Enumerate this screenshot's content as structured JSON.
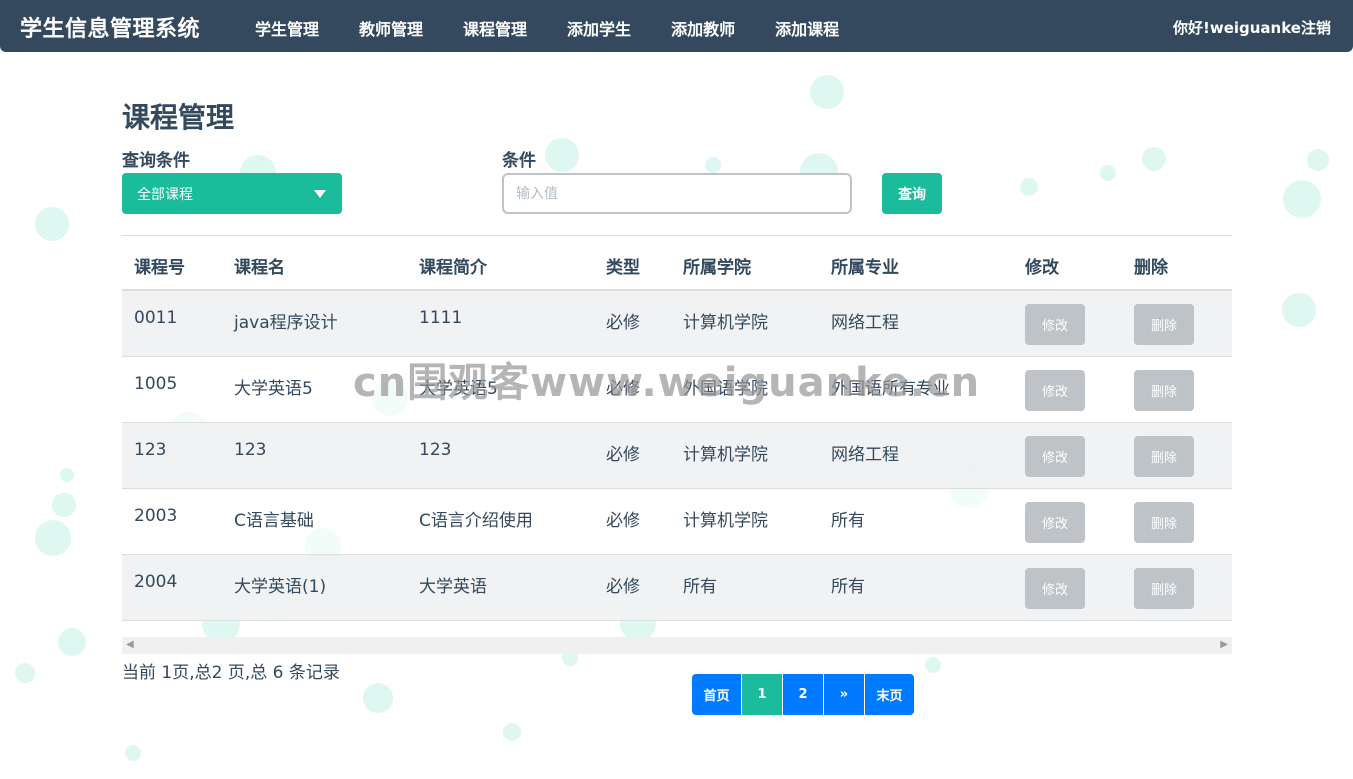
{
  "app": {
    "title": "学生信息管理系统"
  },
  "nav": {
    "items": [
      {
        "label": "学生管理"
      },
      {
        "label": "教师管理"
      },
      {
        "label": "课程管理"
      },
      {
        "label": "添加学生"
      },
      {
        "label": "添加教师"
      },
      {
        "label": "添加课程"
      }
    ],
    "greeting": "你好!weiguanke",
    "logout": "注销"
  },
  "page": {
    "title": "课程管理"
  },
  "filters": {
    "condition_label": "查询条件",
    "condition_value": "全部课程",
    "value_label": "条件",
    "input_placeholder": "输入值",
    "input_value": "",
    "query_button": "查询"
  },
  "table": {
    "headers": [
      "课程号",
      "课程名",
      "课程简介",
      "类型",
      "所属学院",
      "所属专业",
      "修改",
      "删除"
    ],
    "rows": [
      {
        "id": "0011",
        "name": "java程序设计",
        "intro": "1111",
        "type": "必修",
        "college": "计算机学院",
        "major": "网络工程",
        "edit": "修改",
        "delete": "删除"
      },
      {
        "id": "1005",
        "name": "大学英语5",
        "intro": "大学英语5",
        "type": "必修",
        "college": "外国语学院",
        "major": "外国语所有专业",
        "edit": "修改",
        "delete": "删除"
      },
      {
        "id": "123",
        "name": "123",
        "intro": "123",
        "type": "必修",
        "college": "计算机学院",
        "major": "网络工程",
        "edit": "修改",
        "delete": "删除"
      },
      {
        "id": "2003",
        "name": "C语言基础",
        "intro": "C语言介绍使用",
        "type": "必修",
        "college": "计算机学院",
        "major": "所有",
        "edit": "修改",
        "delete": "删除"
      },
      {
        "id": "2004",
        "name": "大学英语(1)",
        "intro": "大学英语",
        "type": "必修",
        "college": "所有",
        "major": "所有",
        "edit": "修改",
        "delete": "删除"
      }
    ]
  },
  "pagination": {
    "summary": "当前 1页,总2 页,总 6 条记录",
    "first": "首页",
    "pages": [
      "1",
      "2"
    ],
    "active_page": "1",
    "next": "»",
    "last": "末页"
  },
  "watermark": "cn围观客www.weiguanke.cn",
  "colors": {
    "navbar": "#34495e",
    "accent": "#1abc9c",
    "pager": "#007bff",
    "disabled_button": "#bdc3c7"
  }
}
